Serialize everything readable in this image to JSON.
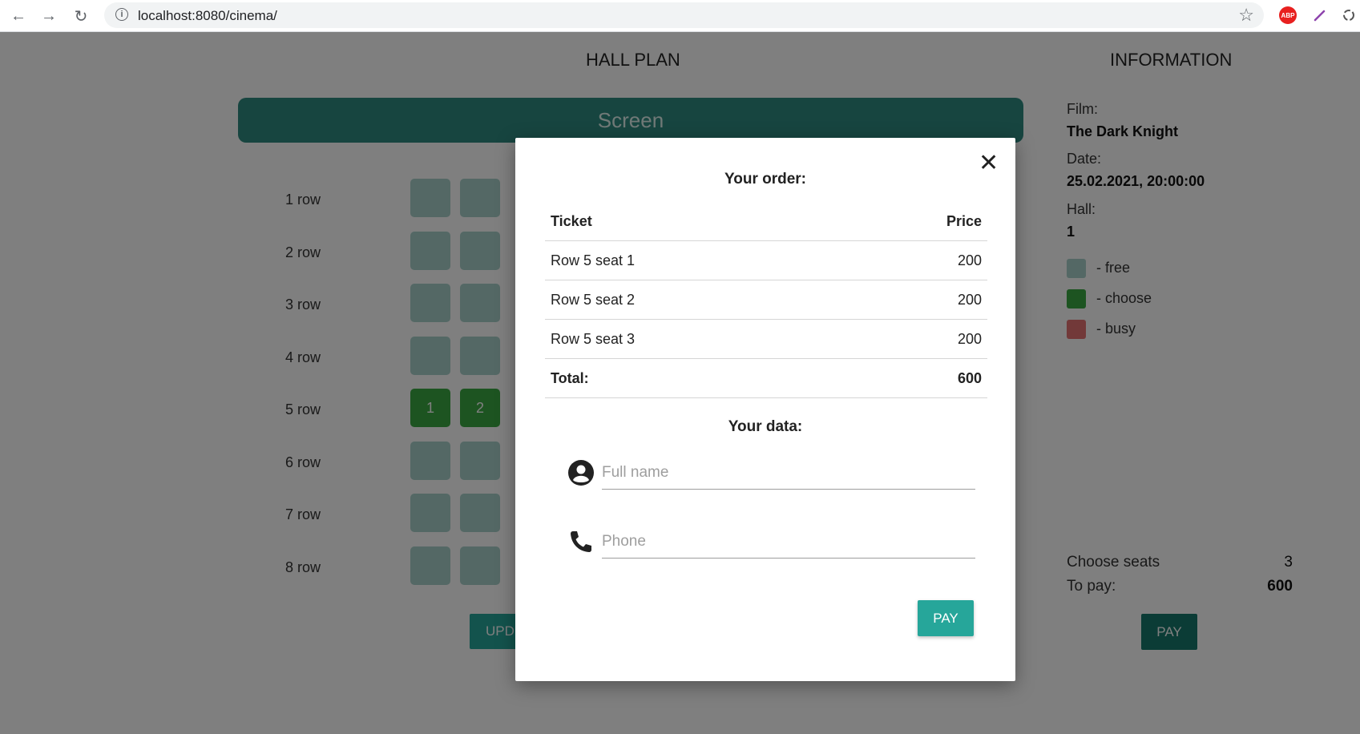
{
  "browser": {
    "url": "localhost:8080/cinema/",
    "info_icon": "info-icon",
    "extensions": [
      "adblock-plus-icon",
      "pen-icon",
      "recycle-icon"
    ],
    "abp_label": "ABP"
  },
  "hall": {
    "title": "HALL PLAN",
    "screen_label": "Screen",
    "rows": [
      {
        "label": "1 row",
        "seats": [
          {
            "label": "",
            "status": "free"
          },
          {
            "label": "",
            "status": "free"
          }
        ]
      },
      {
        "label": "2 row",
        "seats": [
          {
            "label": "",
            "status": "free"
          },
          {
            "label": "",
            "status": "free"
          }
        ]
      },
      {
        "label": "3 row",
        "seats": [
          {
            "label": "",
            "status": "free"
          },
          {
            "label": "",
            "status": "free"
          }
        ]
      },
      {
        "label": "4 row",
        "seats": [
          {
            "label": "",
            "status": "free"
          },
          {
            "label": "",
            "status": "free"
          }
        ]
      },
      {
        "label": "5 row",
        "seats": [
          {
            "label": "1",
            "status": "choose"
          },
          {
            "label": "2",
            "status": "choose"
          }
        ]
      },
      {
        "label": "6 row",
        "seats": [
          {
            "label": "",
            "status": "free"
          },
          {
            "label": "",
            "status": "free"
          }
        ]
      },
      {
        "label": "7 row",
        "seats": [
          {
            "label": "",
            "status": "free"
          },
          {
            "label": "",
            "status": "free"
          }
        ]
      },
      {
        "label": "8 row",
        "seats": [
          {
            "label": "",
            "status": "free"
          },
          {
            "label": "",
            "status": "free"
          }
        ]
      }
    ],
    "update_label": "UPD"
  },
  "info": {
    "title": "INFORMATION",
    "film_label": "Film:",
    "film_value": "The Dark Knight",
    "date_label": "Date:",
    "date_value": "25.02.2021, 20:00:00",
    "hall_label": "Hall:",
    "hall_value": "1",
    "legend": [
      {
        "text": "- free",
        "color": "#a8d0cb"
      },
      {
        "text": "- choose",
        "color": "#3aa843"
      },
      {
        "text": "- busy",
        "color": "#e57373"
      }
    ],
    "choose_seats_label": "Choose seats",
    "choose_seats_value": "3",
    "to_pay_label": "To pay:",
    "to_pay_value": "600",
    "pay_label": "PAY"
  },
  "modal": {
    "order_heading": "Your order:",
    "close_icon": "close-icon",
    "table_headers": {
      "ticket": "Ticket",
      "price": "Price"
    },
    "tickets": [
      {
        "ticket": "Row 5 seat 1",
        "price": "200"
      },
      {
        "ticket": "Row 5 seat 2",
        "price": "200"
      },
      {
        "ticket": "Row 5 seat 3",
        "price": "200"
      }
    ],
    "total_label": "Total:",
    "total_value": "600",
    "data_heading": "Your data:",
    "name_placeholder": "Full name",
    "name_value": "",
    "phone_placeholder": "Phone",
    "phone_value": "",
    "pay_label": "PAY"
  }
}
